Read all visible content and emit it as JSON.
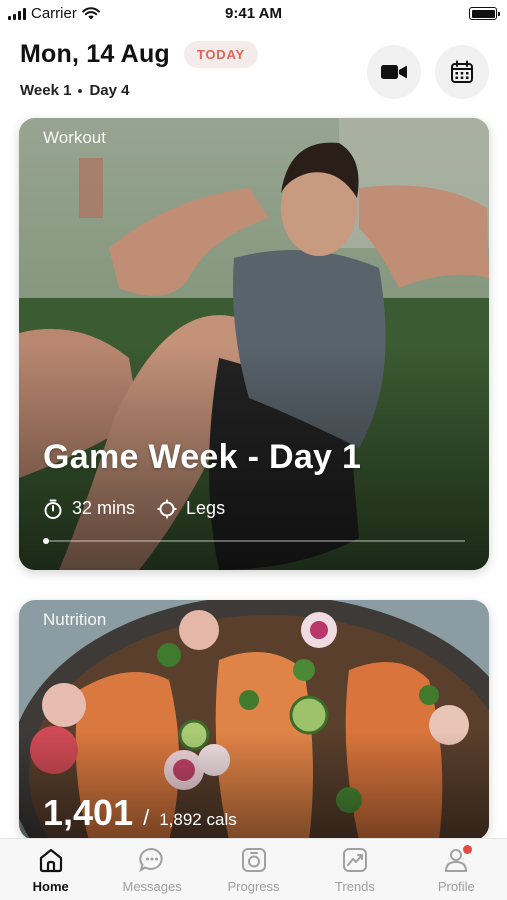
{
  "status_bar": {
    "carrier": "Carrier",
    "time": "9:41 AM"
  },
  "header": {
    "date": "Mon, 14 Aug",
    "badge": "TODAY",
    "week": "Week 1",
    "day": "Day 4",
    "icons": [
      "video-camera-icon",
      "calendar-icon"
    ]
  },
  "workout": {
    "section_label": "Workout",
    "title": "Game Week - Day 1",
    "duration": "32 mins",
    "focus": "Legs",
    "progress": 0.0
  },
  "nutrition": {
    "section_label": "Nutrition",
    "calories_consumed": "1,401",
    "separator": "/",
    "calories_goal": "1,892 cals"
  },
  "tabs": [
    {
      "label": "Home",
      "icon": "home-icon",
      "active": true
    },
    {
      "label": "Messages",
      "icon": "chat-bubble-icon",
      "active": false
    },
    {
      "label": "Progress",
      "icon": "progress-icon",
      "active": false
    },
    {
      "label": "Trends",
      "icon": "trends-icon",
      "active": false
    },
    {
      "label": "Profile",
      "icon": "profile-icon",
      "active": false,
      "notification": true
    }
  ],
  "colors": {
    "accent": "#e06459",
    "notification": "#e5493f",
    "tab_inactive": "#a0a0a0"
  }
}
